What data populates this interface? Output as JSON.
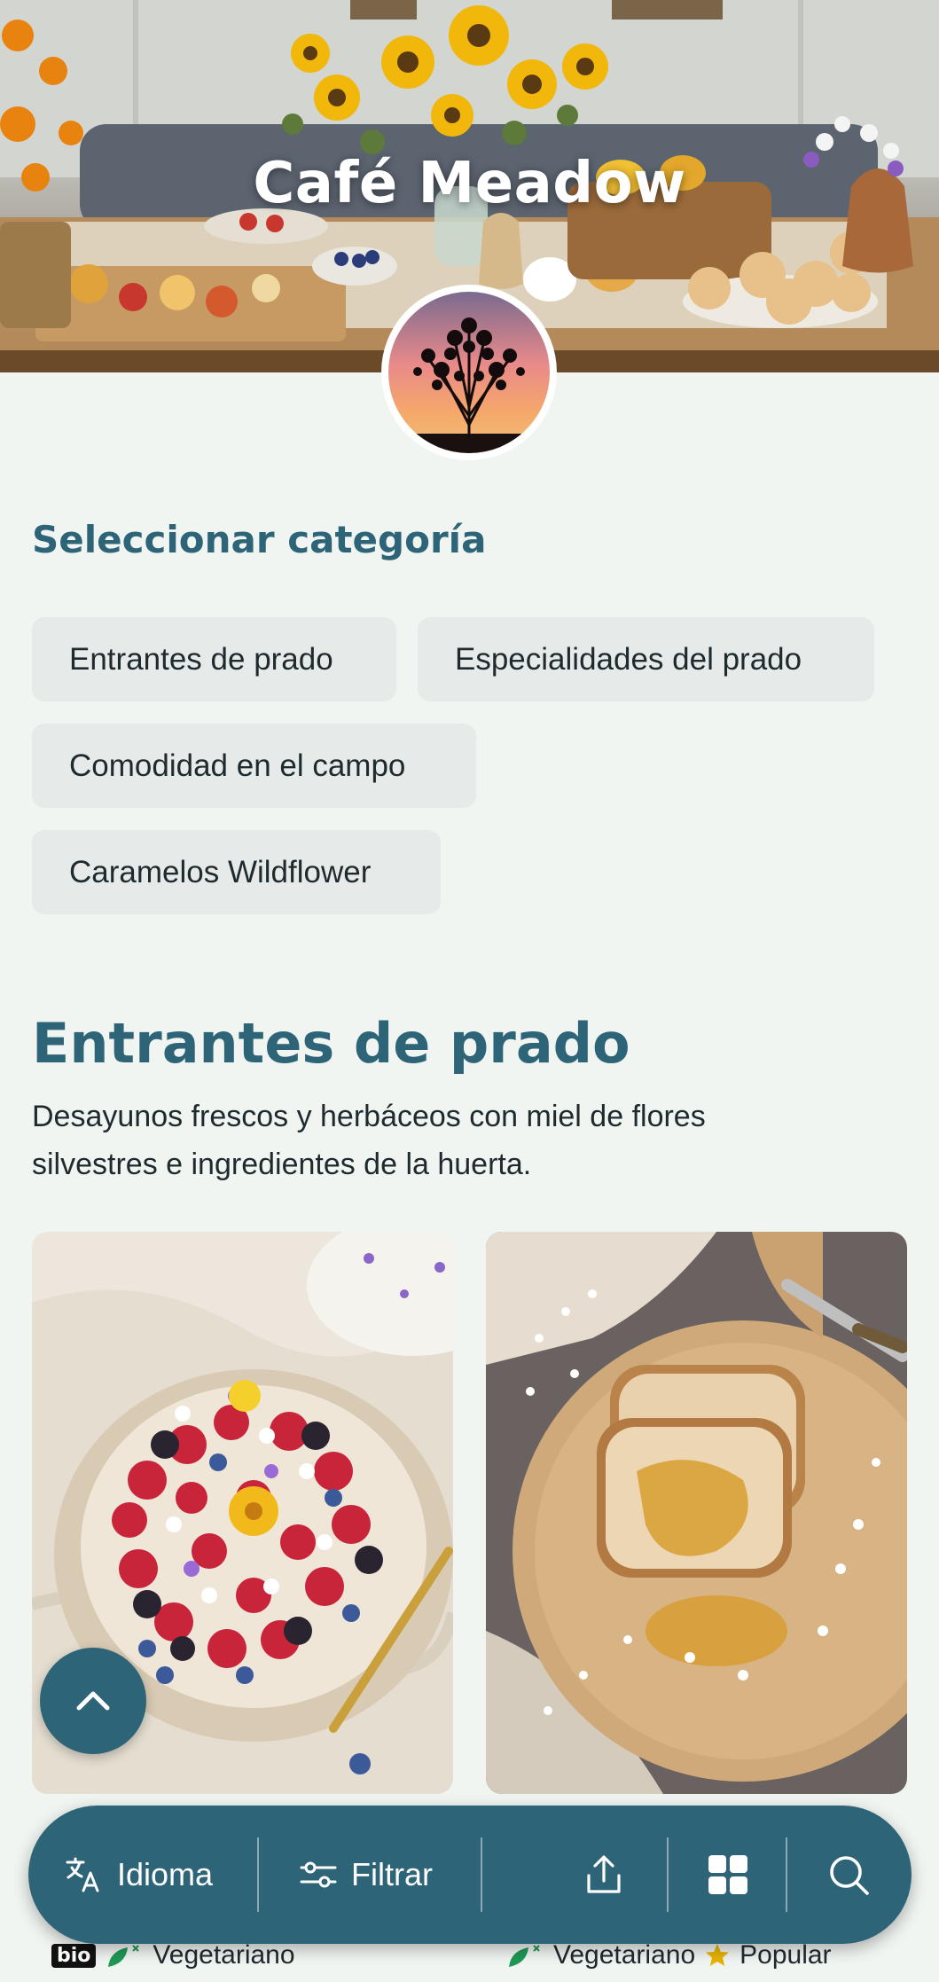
{
  "hero": {
    "title": "Café Meadow"
  },
  "categories": {
    "heading": "Seleccionar categoría",
    "items": [
      {
        "label": "Entrantes de prado"
      },
      {
        "label": "Especialidades del prado"
      },
      {
        "label": "Comodidad en el campo"
      },
      {
        "label": "Caramelos Wildflower"
      }
    ]
  },
  "section": {
    "title": "Entrantes de prado",
    "description": "Desayunos frescos y herbáceos con miel de flores silvestres e ingredientes de la huerta.",
    "cards": [
      {
        "image": "berry-bowl-with-edible-flowers",
        "badges": {
          "bio": "bio",
          "tags": [
            "Vegetariano"
          ]
        }
      },
      {
        "image": "honey-toast-on-wooden-board",
        "badges": {
          "tags": [
            "Vegetariano",
            "Popular"
          ]
        }
      }
    ]
  },
  "bottom_bar": {
    "language_label": "Idioma",
    "filter_label": "Filtrar"
  },
  "colors": {
    "accent": "#2e6477",
    "chip_bg": "#e6ebe9",
    "page_bg": "#f1f5f2",
    "popular_star": "#e8b400",
    "vegetarian_icon": "#1f9a55"
  }
}
